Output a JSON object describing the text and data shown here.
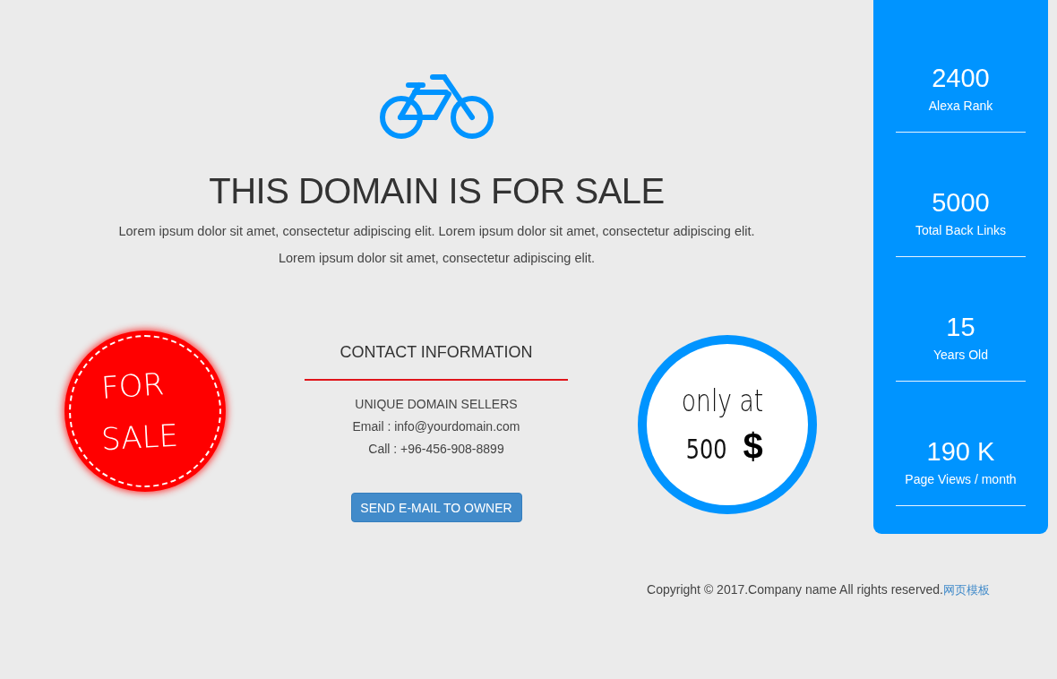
{
  "hero": {
    "title": "THIS DOMAIN IS FOR SALE",
    "description": [
      "Lorem ipsum dolor sit amet, consectetur adipiscing elit. Lorem ipsum dolor sit amet, consectetur adipiscing elit.",
      "Lorem ipsum dolor sit amet, consectetur adipiscing elit."
    ]
  },
  "sale_badge": {
    "lines": [
      "FOR",
      "SALE"
    ]
  },
  "contact": {
    "heading": "CONTACT INFORMATION",
    "company": "UNIQUE DOMAIN SELLERS",
    "email": "Email : info@yourdomain.com",
    "phone": "Call : +96-456-908-8899",
    "button": "SEND E-MAIL TO OWNER"
  },
  "price_badge": {
    "intro": "only at",
    "amount": "500",
    "currency": "$"
  },
  "stats": [
    {
      "value": "2400",
      "label": "Alexa Rank"
    },
    {
      "value": "5000",
      "label": "Total Back Links"
    },
    {
      "value": "15",
      "label": "Years Old"
    },
    {
      "value": "190 K",
      "label": "Page Views / month"
    }
  ],
  "footer": {
    "copyright": "Copyright © 2017.Company name All rights reserved.",
    "link": "网页模板"
  }
}
